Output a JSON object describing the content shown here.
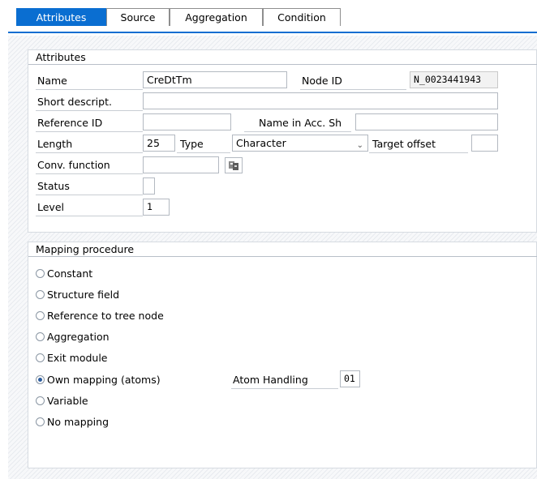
{
  "tabs": [
    {
      "label": "Attributes",
      "active": true
    },
    {
      "label": "Source",
      "active": false
    },
    {
      "label": "Aggregation",
      "active": false
    },
    {
      "label": "Condition",
      "active": false
    }
  ],
  "attributes": {
    "title": "Attributes",
    "name_label": "Name",
    "name_value": "CreDtTm",
    "node_id_label": "Node ID",
    "node_id_value": "N_0023441943",
    "short_descript_label": "Short descript.",
    "short_descript_value": "",
    "reference_id_label": "Reference ID",
    "reference_id_value": "",
    "name_in_acc_label": "Name in Acc. Sh",
    "name_in_acc_value": "",
    "length_label": "Length",
    "length_value": "25",
    "type_label": "Type",
    "type_value": "Character",
    "target_offset_label": "Target offset",
    "target_offset_value": "",
    "conv_function_label": "Conv. function",
    "conv_function_value": "",
    "status_label": "Status",
    "status_value": "",
    "level_label": "Level",
    "level_value": "1"
  },
  "mapping": {
    "title": "Mapping procedure",
    "options": [
      {
        "label": "Constant",
        "selected": false
      },
      {
        "label": "Structure field",
        "selected": false
      },
      {
        "label": "Reference to tree node",
        "selected": false
      },
      {
        "label": "Aggregation",
        "selected": false
      },
      {
        "label": "Exit module",
        "selected": false
      },
      {
        "label": "Own mapping (atoms)",
        "selected": true
      },
      {
        "label": "Variable",
        "selected": false
      },
      {
        "label": "No mapping",
        "selected": false
      }
    ],
    "atom_handling_label": "Atom Handling",
    "atom_handling_value": "01"
  },
  "colors": {
    "accent": "#0a6ed1",
    "radio_selected": "#2b5c9e"
  }
}
